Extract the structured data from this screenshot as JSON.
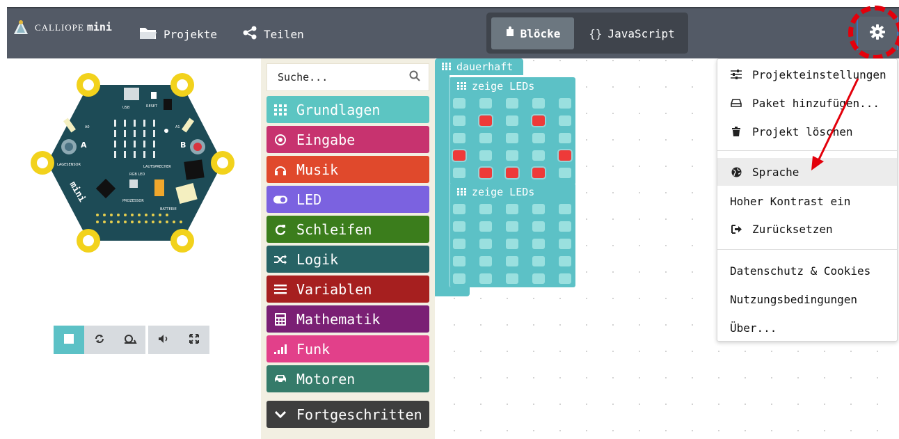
{
  "header": {
    "brand_small": "CALLIOPE",
    "brand_name": "mini",
    "projects_label": "Projekte",
    "share_label": "Teilen",
    "blocks_label": "Blöcke",
    "javascript_label": "JavaScript",
    "js_glyph": "{}"
  },
  "toolbox": {
    "search_placeholder": "Suche...",
    "categories": [
      {
        "label": "Grundlagen",
        "icon": "grid-icon",
        "color": "#5cc5c2"
      },
      {
        "label": "Eingabe",
        "icon": "target-icon",
        "color": "#c7336f"
      },
      {
        "label": "Musik",
        "icon": "headphones-icon",
        "color": "#e0492c"
      },
      {
        "label": "LED",
        "icon": "toggle-icon",
        "color": "#7b62e0"
      },
      {
        "label": "Schleifen",
        "icon": "refresh-icon",
        "color": "#3b7d1c"
      },
      {
        "label": "Logik",
        "icon": "shuffle-icon",
        "color": "#276365"
      },
      {
        "label": "Variablen",
        "icon": "list-icon",
        "color": "#a61f1f"
      },
      {
        "label": "Mathematik",
        "icon": "calculator-icon",
        "color": "#7a1f74"
      },
      {
        "label": "Funk",
        "icon": "signal-icon",
        "color": "#e2408a"
      },
      {
        "label": "Motoren",
        "icon": "car-icon",
        "color": "#357b6a"
      },
      {
        "label": "Fortgeschritten",
        "icon": "chevron-down-icon",
        "color": "#3e3e3e"
      }
    ]
  },
  "workspace": {
    "forever_label": "dauerhaft",
    "show_leds_label_1": "zeige LEDs",
    "show_leds_label_2": "zeige LEDs",
    "grid1": [
      [
        0,
        0,
        0,
        0,
        0
      ],
      [
        0,
        1,
        0,
        1,
        0
      ],
      [
        0,
        0,
        0,
        0,
        0
      ],
      [
        1,
        0,
        0,
        0,
        1
      ],
      [
        0,
        1,
        1,
        1,
        0
      ]
    ],
    "grid2": [
      [
        0,
        0,
        0,
        0,
        0
      ],
      [
        0,
        0,
        0,
        0,
        0
      ],
      [
        0,
        0,
        0,
        0,
        0
      ],
      [
        0,
        0,
        0,
        0,
        0
      ],
      [
        0,
        0,
        0,
        0,
        0
      ]
    ]
  },
  "menu": {
    "items": [
      {
        "label": "Projekteinstellungen",
        "icon": "sliders-icon"
      },
      {
        "label": "Paket hinzufügen...",
        "icon": "drive-icon"
      },
      {
        "label": "Projekt löschen",
        "icon": "trash-icon"
      },
      {
        "label": "Sprache",
        "icon": "globe-icon"
      },
      {
        "label": "Hoher Kontrast ein",
        "icon": ""
      },
      {
        "label": "Zurücksetzen",
        "icon": "sign-out-icon"
      },
      {
        "label": "Datenschutz & Cookies",
        "icon": ""
      },
      {
        "label": "Nutzungsbedingungen",
        "icon": ""
      },
      {
        "label": "Über...",
        "icon": ""
      }
    ]
  },
  "simulator": {
    "labels": [
      "USB",
      "RESET",
      "A0",
      "A1",
      "A",
      "B",
      "LAGESENSOR",
      "LAUTSPRECHER",
      "RGB LED",
      "PROZESSOR",
      "BATTERIE",
      "calliope",
      "mini"
    ],
    "controls": [
      "stop-icon",
      "restart-icon",
      "slow-icon",
      "mute-icon",
      "fullscreen-icon"
    ]
  },
  "colors": {
    "header_bg": "#535a66",
    "accent": "#5cc1c6",
    "led_on": "#ee3a39",
    "annotation": "#e3000b"
  }
}
